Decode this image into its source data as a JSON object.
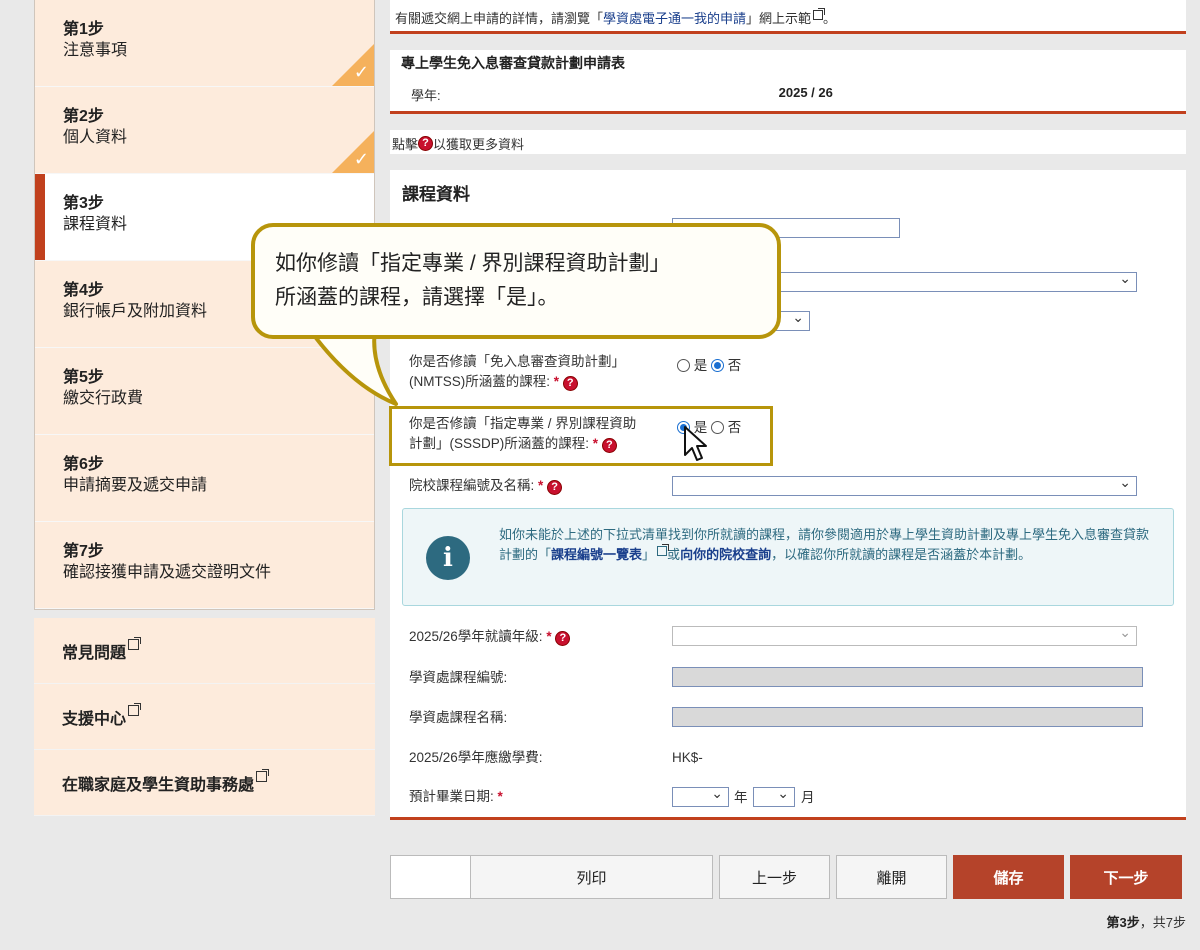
{
  "sidebar": {
    "steps": [
      {
        "num": "第1步",
        "title": "注意事項",
        "state": "done"
      },
      {
        "num": "第2步",
        "title": "個人資料",
        "state": "done"
      },
      {
        "num": "第3步",
        "title": "課程資料",
        "state": "current"
      },
      {
        "num": "第4步",
        "title": "銀行帳戶及附加資料",
        "state": "pending"
      },
      {
        "num": "第5步",
        "title": "繳交行政費",
        "state": "pending"
      },
      {
        "num": "第6步",
        "title": "申請摘要及遞交申請",
        "state": "pending"
      },
      {
        "num": "第7步",
        "title": "確認接獲申請及遞交證明文件",
        "state": "pending"
      }
    ],
    "links": [
      "常見問題",
      "支援中心",
      "在職家庭及學生資助事務處"
    ]
  },
  "topnote": {
    "text_pre": "有關遞交網上申請的詳情，請瀏覽「",
    "link": "學資處電子通一我的申請",
    "text_post": "」網上示範",
    "end": "。"
  },
  "form_header": {
    "title": "專上學生免入息審查貸款計劃申請表",
    "year_label": "學年:",
    "year_value": "2025 / 26"
  },
  "hint": {
    "pre": "點擊",
    "post": "以獲取更多資料"
  },
  "course": {
    "heading": "課程資料",
    "q_nmtss_l1": "你是否修讀「免入息審查資助計劃」",
    "q_nmtss_l2": "(NMTSS)所涵蓋的課程:",
    "q_sssdp_l1": "你是否修讀「指定專業 / 界別課程資助",
    "q_sssdp_l2": "計劃」(SSSDP)所涵蓋的課程:",
    "yes": "是",
    "no": "否",
    "req_mark": "*",
    "course_code_label": "院校課程編號及名稱:",
    "info_pre": "如你未能於上述的下拉式清單找到你所就讀的課程，請你參閱適用於專上學生資助計劃及專上學生免入息審查貸款計劃的「",
    "info_link1": "課程編號一覽表",
    "info_mid": "」",
    "info_mid2": "或",
    "info_link2": "向你的院校查詢",
    "info_post": "，以確認你所就讀的課程是否涵蓋於本計劃。",
    "grade_label": "2025/26學年就讀年級:",
    "sfo_code_label": "學資處課程編號:",
    "sfo_name_label": "學資處課程名稱:",
    "fee_label": "2025/26學年應繳學費:",
    "fee_value": "HK$-",
    "grad_label": "預計畢業日期:",
    "year_unit": "年",
    "month_unit": "月"
  },
  "callout": {
    "line1": "如你修讀「指定專業 / 界別課程資助計劃」",
    "line2": "所涵蓋的課程，請選擇「是」。"
  },
  "buttons": {
    "print": "列印",
    "prev": "上一步",
    "leave": "離開",
    "save": "儲存",
    "next": "下一步"
  },
  "page_indicator": {
    "current": "第3步",
    "sep": "，",
    "total": "共7步"
  },
  "colors": {
    "accent": "#c1401d",
    "primary_button": "#b5432a",
    "sidebar_bg": "#fdebdc",
    "done_badge": "#f5b15c",
    "callout_border": "#b7950b"
  }
}
